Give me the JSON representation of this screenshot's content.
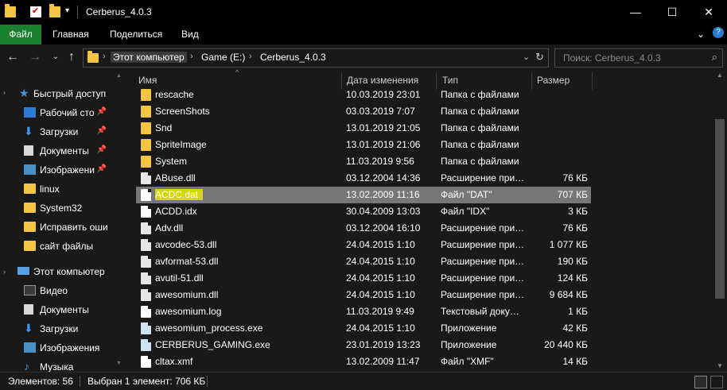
{
  "window": {
    "title": "Cerberus_4.0.3",
    "minimize_label": "—",
    "maximize_label": "☐",
    "close_label": "✕",
    "help_label": "?",
    "collapse_label": "⌄"
  },
  "ribbon": {
    "tabs": [
      "Файл",
      "Главная",
      "Поделиться",
      "Вид"
    ]
  },
  "address": {
    "crumbs": [
      "Этот компьютер",
      "Game (E:)",
      "Cerberus_4.0.3"
    ],
    "search_placeholder": "Поиск: Cerberus_4.0.3"
  },
  "nav": {
    "items": [
      {
        "label": "Быстрый доступ",
        "icon": "star-icon",
        "pinned": false
      },
      {
        "label": "Рабочий сто…",
        "icon": "desktop-icon",
        "pinned": true
      },
      {
        "label": "Загрузки",
        "icon": "download-icon",
        "pinned": true
      },
      {
        "label": "Документы",
        "icon": "documents-icon",
        "pinned": true
      },
      {
        "label": "Изображени",
        "icon": "pictures-icon",
        "pinned": true
      },
      {
        "label": "linux",
        "icon": "folder-icon",
        "pinned": false
      },
      {
        "label": "System32",
        "icon": "folder-icon",
        "pinned": false
      },
      {
        "label": "Исправить оши",
        "icon": "folder-icon",
        "pinned": false
      },
      {
        "label": "сайт файлы",
        "icon": "folder-icon",
        "pinned": false
      },
      {
        "label": "Этот компьютер",
        "icon": "computer-icon",
        "pinned": false
      },
      {
        "label": "Видео",
        "icon": "video-icon",
        "pinned": false
      },
      {
        "label": "Документы",
        "icon": "documents-icon",
        "pinned": false
      },
      {
        "label": "Загрузки",
        "icon": "download-icon",
        "pinned": false
      },
      {
        "label": "Изображения",
        "icon": "pictures-icon",
        "pinned": false
      },
      {
        "label": "Музыка",
        "icon": "music-icon",
        "pinned": false
      }
    ]
  },
  "table": {
    "columns": [
      "Имя",
      "Дата изменения",
      "Тип",
      "Размер"
    ],
    "rows": [
      {
        "name": "rescache",
        "date": "10.03.2019 23:01",
        "type": "Папка с файлами",
        "size": "",
        "kind": "folder"
      },
      {
        "name": "ScreenShots",
        "date": "03.03.2019 7:07",
        "type": "Папка с файлами",
        "size": "",
        "kind": "folder"
      },
      {
        "name": "Snd",
        "date": "13.01.2019 21:05",
        "type": "Папка с файлами",
        "size": "",
        "kind": "folder"
      },
      {
        "name": "SpriteImage",
        "date": "13.01.2019 21:06",
        "type": "Папка с файлами",
        "size": "",
        "kind": "folder"
      },
      {
        "name": "System",
        "date": "11.03.2019 9:56",
        "type": "Папка с файлами",
        "size": "",
        "kind": "folder"
      },
      {
        "name": "ABuse.dll",
        "date": "03.12.2004 14:36",
        "type": "Расширение при…",
        "size": "76 КБ",
        "kind": "dll"
      },
      {
        "name": "ACDC.dat",
        "date": "13.02.2009 11:16",
        "type": "Файл \"DAT\"",
        "size": "707 КБ",
        "kind": "file",
        "selected": true
      },
      {
        "name": "ACDD.idx",
        "date": "30.04.2009 13:03",
        "type": "Файл \"IDX\"",
        "size": "3 КБ",
        "kind": "file"
      },
      {
        "name": "Adv.dll",
        "date": "03.12.2004 16:10",
        "type": "Расширение при…",
        "size": "76 КБ",
        "kind": "dll"
      },
      {
        "name": "avcodec-53.dll",
        "date": "24.04.2015 1:10",
        "type": "Расширение при…",
        "size": "1 077 КБ",
        "kind": "dll"
      },
      {
        "name": "avformat-53.dll",
        "date": "24.04.2015 1:10",
        "type": "Расширение при…",
        "size": "190 КБ",
        "kind": "dll"
      },
      {
        "name": "avutil-51.dll",
        "date": "24.04.2015 1:10",
        "type": "Расширение при…",
        "size": "124 КБ",
        "kind": "dll"
      },
      {
        "name": "awesomium.dll",
        "date": "24.04.2015 1:10",
        "type": "Расширение при…",
        "size": "9 684 КБ",
        "kind": "dll"
      },
      {
        "name": "awesomium.log",
        "date": "11.03.2019 9:49",
        "type": "Текстовый доку…",
        "size": "1 КБ",
        "kind": "file"
      },
      {
        "name": "awesomium_process.exe",
        "date": "24.04.2015 1:10",
        "type": "Приложение",
        "size": "42 КБ",
        "kind": "exe"
      },
      {
        "name": "CERBERUS_GAMING.exe",
        "date": "23.01.2019 13:23",
        "type": "Приложение",
        "size": "20 440 КБ",
        "kind": "exe"
      },
      {
        "name": "cltax.xmf",
        "date": "13.02.2009 11:47",
        "type": "Файл \"XMF\"",
        "size": "14 КБ",
        "kind": "file"
      }
    ]
  },
  "status": {
    "count": "Элементов: 56",
    "selected": "Выбран 1 элемент: 706 КБ"
  },
  "colors": {
    "accent_file_tab": "#1a7f2e",
    "folder": "#f4c542",
    "selected_row": "#777777",
    "highlight": "#d6d600"
  }
}
